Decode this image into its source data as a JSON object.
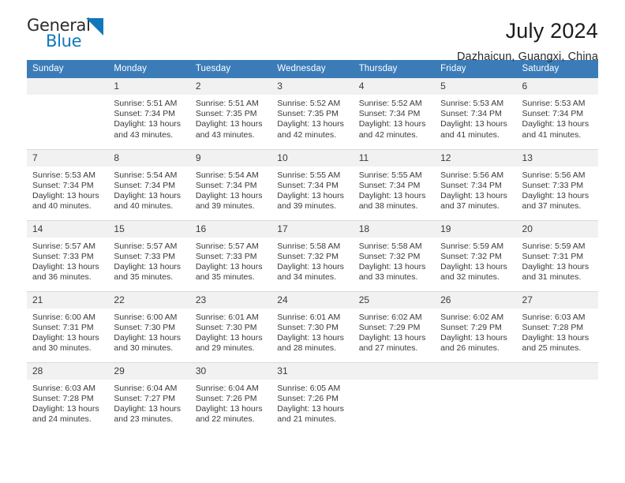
{
  "brand": {
    "name_part1": "General",
    "name_part2": "Blue",
    "triangle_icon": "triangle-icon",
    "accent_color": "#1077bd"
  },
  "header": {
    "month_title": "July 2024",
    "location": "Dazhaicun, Guangxi, China",
    "header_bg_color": "#3b7cb8",
    "daynum_bg_color": "#f1f1f1"
  },
  "weekday_headers": [
    "Sunday",
    "Monday",
    "Tuesday",
    "Wednesday",
    "Thursday",
    "Friday",
    "Saturday"
  ],
  "labels": {
    "sunrise": "Sunrise:",
    "sunset": "Sunset:",
    "daylight": "Daylight:"
  },
  "weeks": [
    [
      {
        "day": "",
        "blank": true,
        "sunrise": "",
        "sunset": "",
        "daylight_line1": "",
        "daylight_line2": ""
      },
      {
        "day": "1",
        "sunrise": "Sunrise: 5:51 AM",
        "sunset": "Sunset: 7:34 PM",
        "daylight_line1": "Daylight: 13 hours",
        "daylight_line2": "and 43 minutes."
      },
      {
        "day": "2",
        "sunrise": "Sunrise: 5:51 AM",
        "sunset": "Sunset: 7:35 PM",
        "daylight_line1": "Daylight: 13 hours",
        "daylight_line2": "and 43 minutes."
      },
      {
        "day": "3",
        "sunrise": "Sunrise: 5:52 AM",
        "sunset": "Sunset: 7:35 PM",
        "daylight_line1": "Daylight: 13 hours",
        "daylight_line2": "and 42 minutes."
      },
      {
        "day": "4",
        "sunrise": "Sunrise: 5:52 AM",
        "sunset": "Sunset: 7:34 PM",
        "daylight_line1": "Daylight: 13 hours",
        "daylight_line2": "and 42 minutes."
      },
      {
        "day": "5",
        "sunrise": "Sunrise: 5:53 AM",
        "sunset": "Sunset: 7:34 PM",
        "daylight_line1": "Daylight: 13 hours",
        "daylight_line2": "and 41 minutes."
      },
      {
        "day": "6",
        "sunrise": "Sunrise: 5:53 AM",
        "sunset": "Sunset: 7:34 PM",
        "daylight_line1": "Daylight: 13 hours",
        "daylight_line2": "and 41 minutes."
      }
    ],
    [
      {
        "day": "7",
        "sunrise": "Sunrise: 5:53 AM",
        "sunset": "Sunset: 7:34 PM",
        "daylight_line1": "Daylight: 13 hours",
        "daylight_line2": "and 40 minutes."
      },
      {
        "day": "8",
        "sunrise": "Sunrise: 5:54 AM",
        "sunset": "Sunset: 7:34 PM",
        "daylight_line1": "Daylight: 13 hours",
        "daylight_line2": "and 40 minutes."
      },
      {
        "day": "9",
        "sunrise": "Sunrise: 5:54 AM",
        "sunset": "Sunset: 7:34 PM",
        "daylight_line1": "Daylight: 13 hours",
        "daylight_line2": "and 39 minutes."
      },
      {
        "day": "10",
        "sunrise": "Sunrise: 5:55 AM",
        "sunset": "Sunset: 7:34 PM",
        "daylight_line1": "Daylight: 13 hours",
        "daylight_line2": "and 39 minutes."
      },
      {
        "day": "11",
        "sunrise": "Sunrise: 5:55 AM",
        "sunset": "Sunset: 7:34 PM",
        "daylight_line1": "Daylight: 13 hours",
        "daylight_line2": "and 38 minutes."
      },
      {
        "day": "12",
        "sunrise": "Sunrise: 5:56 AM",
        "sunset": "Sunset: 7:34 PM",
        "daylight_line1": "Daylight: 13 hours",
        "daylight_line2": "and 37 minutes."
      },
      {
        "day": "13",
        "sunrise": "Sunrise: 5:56 AM",
        "sunset": "Sunset: 7:33 PM",
        "daylight_line1": "Daylight: 13 hours",
        "daylight_line2": "and 37 minutes."
      }
    ],
    [
      {
        "day": "14",
        "sunrise": "Sunrise: 5:57 AM",
        "sunset": "Sunset: 7:33 PM",
        "daylight_line1": "Daylight: 13 hours",
        "daylight_line2": "and 36 minutes."
      },
      {
        "day": "15",
        "sunrise": "Sunrise: 5:57 AM",
        "sunset": "Sunset: 7:33 PM",
        "daylight_line1": "Daylight: 13 hours",
        "daylight_line2": "and 35 minutes."
      },
      {
        "day": "16",
        "sunrise": "Sunrise: 5:57 AM",
        "sunset": "Sunset: 7:33 PM",
        "daylight_line1": "Daylight: 13 hours",
        "daylight_line2": "and 35 minutes."
      },
      {
        "day": "17",
        "sunrise": "Sunrise: 5:58 AM",
        "sunset": "Sunset: 7:32 PM",
        "daylight_line1": "Daylight: 13 hours",
        "daylight_line2": "and 34 minutes."
      },
      {
        "day": "18",
        "sunrise": "Sunrise: 5:58 AM",
        "sunset": "Sunset: 7:32 PM",
        "daylight_line1": "Daylight: 13 hours",
        "daylight_line2": "and 33 minutes."
      },
      {
        "day": "19",
        "sunrise": "Sunrise: 5:59 AM",
        "sunset": "Sunset: 7:32 PM",
        "daylight_line1": "Daylight: 13 hours",
        "daylight_line2": "and 32 minutes."
      },
      {
        "day": "20",
        "sunrise": "Sunrise: 5:59 AM",
        "sunset": "Sunset: 7:31 PM",
        "daylight_line1": "Daylight: 13 hours",
        "daylight_line2": "and 31 minutes."
      }
    ],
    [
      {
        "day": "21",
        "sunrise": "Sunrise: 6:00 AM",
        "sunset": "Sunset: 7:31 PM",
        "daylight_line1": "Daylight: 13 hours",
        "daylight_line2": "and 30 minutes."
      },
      {
        "day": "22",
        "sunrise": "Sunrise: 6:00 AM",
        "sunset": "Sunset: 7:30 PM",
        "daylight_line1": "Daylight: 13 hours",
        "daylight_line2": "and 30 minutes."
      },
      {
        "day": "23",
        "sunrise": "Sunrise: 6:01 AM",
        "sunset": "Sunset: 7:30 PM",
        "daylight_line1": "Daylight: 13 hours",
        "daylight_line2": "and 29 minutes."
      },
      {
        "day": "24",
        "sunrise": "Sunrise: 6:01 AM",
        "sunset": "Sunset: 7:30 PM",
        "daylight_line1": "Daylight: 13 hours",
        "daylight_line2": "and 28 minutes."
      },
      {
        "day": "25",
        "sunrise": "Sunrise: 6:02 AM",
        "sunset": "Sunset: 7:29 PM",
        "daylight_line1": "Daylight: 13 hours",
        "daylight_line2": "and 27 minutes."
      },
      {
        "day": "26",
        "sunrise": "Sunrise: 6:02 AM",
        "sunset": "Sunset: 7:29 PM",
        "daylight_line1": "Daylight: 13 hours",
        "daylight_line2": "and 26 minutes."
      },
      {
        "day": "27",
        "sunrise": "Sunrise: 6:03 AM",
        "sunset": "Sunset: 7:28 PM",
        "daylight_line1": "Daylight: 13 hours",
        "daylight_line2": "and 25 minutes."
      }
    ],
    [
      {
        "day": "28",
        "sunrise": "Sunrise: 6:03 AM",
        "sunset": "Sunset: 7:28 PM",
        "daylight_line1": "Daylight: 13 hours",
        "daylight_line2": "and 24 minutes."
      },
      {
        "day": "29",
        "sunrise": "Sunrise: 6:04 AM",
        "sunset": "Sunset: 7:27 PM",
        "daylight_line1": "Daylight: 13 hours",
        "daylight_line2": "and 23 minutes."
      },
      {
        "day": "30",
        "sunrise": "Sunrise: 6:04 AM",
        "sunset": "Sunset: 7:26 PM",
        "daylight_line1": "Daylight: 13 hours",
        "daylight_line2": "and 22 minutes."
      },
      {
        "day": "31",
        "sunrise": "Sunrise: 6:05 AM",
        "sunset": "Sunset: 7:26 PM",
        "daylight_line1": "Daylight: 13 hours",
        "daylight_line2": "and 21 minutes."
      },
      {
        "day": "",
        "blank": true,
        "sunrise": "",
        "sunset": "",
        "daylight_line1": "",
        "daylight_line2": ""
      },
      {
        "day": "",
        "blank": true,
        "sunrise": "",
        "sunset": "",
        "daylight_line1": "",
        "daylight_line2": ""
      },
      {
        "day": "",
        "blank": true,
        "sunrise": "",
        "sunset": "",
        "daylight_line1": "",
        "daylight_line2": ""
      }
    ]
  ]
}
